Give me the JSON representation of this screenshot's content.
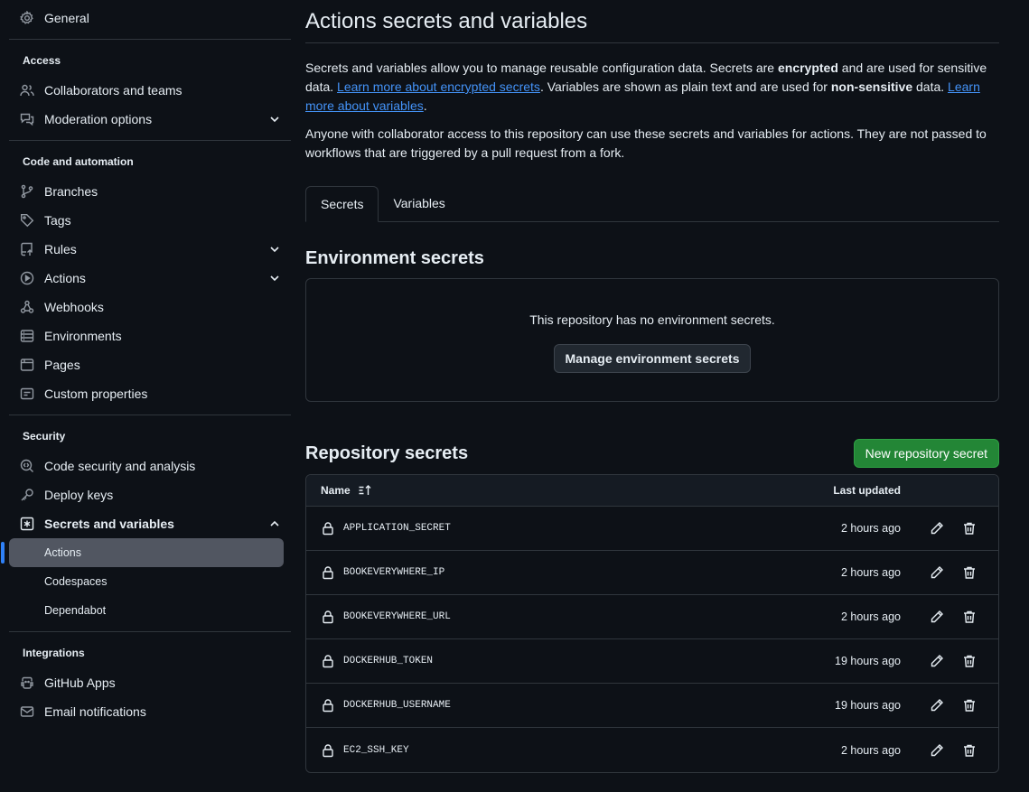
{
  "sidebar": {
    "general": "General",
    "access_head": "Access",
    "collaborators": "Collaborators and teams",
    "moderation": "Moderation options",
    "code_head": "Code and automation",
    "branches": "Branches",
    "tags": "Tags",
    "rules": "Rules",
    "actions": "Actions",
    "webhooks": "Webhooks",
    "environments": "Environments",
    "pages": "Pages",
    "custom_properties": "Custom properties",
    "security_head": "Security",
    "code_security": "Code security and analysis",
    "deploy_keys": "Deploy keys",
    "secrets_vars": "Secrets and variables",
    "sub_actions": "Actions",
    "sub_codespaces": "Codespaces",
    "sub_dependabot": "Dependabot",
    "integrations_head": "Integrations",
    "github_apps": "GitHub Apps",
    "email_notifications": "Email notifications"
  },
  "main": {
    "title": "Actions secrets and variables",
    "desc_part1": "Secrets and variables allow you to manage reusable configuration data. Secrets are ",
    "desc_bold1": "encrypted",
    "desc_part2": " and are used for sensitive data. ",
    "desc_link1": "Learn more about encrypted secrets",
    "desc_part3": ". Variables are shown as plain text and are used for ",
    "desc_bold2": "non-sensitive",
    "desc_part4": " data. ",
    "desc_link2": "Learn more about variables",
    "desc_part5": ".",
    "desc2": "Anyone with collaborator access to this repository can use these secrets and variables for actions. They are not passed to workflows that are triggered by a pull request from a fork.",
    "tab_secrets": "Secrets",
    "tab_variables": "Variables",
    "env_title": "Environment secrets",
    "env_empty": "This repository has no environment secrets.",
    "env_button": "Manage environment secrets",
    "repo_title": "Repository secrets",
    "new_button": "New repository secret",
    "col_name": "Name",
    "col_updated": "Last updated"
  },
  "secrets": [
    {
      "name": "APPLICATION_SECRET",
      "updated": "2 hours ago"
    },
    {
      "name": "BOOKEVERYWHERE_IP",
      "updated": "2 hours ago"
    },
    {
      "name": "BOOKEVERYWHERE_URL",
      "updated": "2 hours ago"
    },
    {
      "name": "DOCKERHUB_TOKEN",
      "updated": "19 hours ago"
    },
    {
      "name": "DOCKERHUB_USERNAME",
      "updated": "19 hours ago"
    },
    {
      "name": "EC2_SSH_KEY",
      "updated": "2 hours ago"
    }
  ],
  "colors": {
    "background": "#0d1117",
    "border": "#30363d",
    "link": "#4493f8",
    "green_button": "#238636",
    "active_item": "#515661",
    "active_indicator": "#2f81f7"
  }
}
